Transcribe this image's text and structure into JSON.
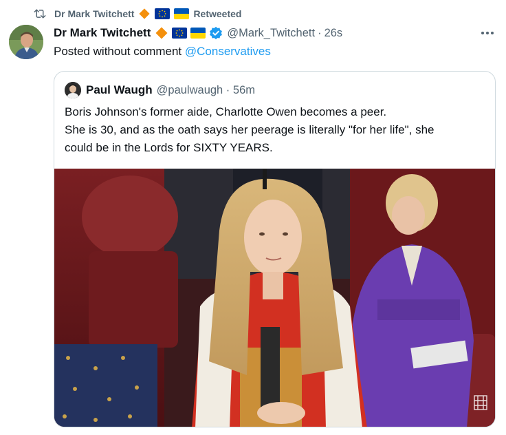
{
  "retweet": {
    "author": "Dr Mark Twitchett",
    "label": "Retweeted"
  },
  "tweet": {
    "author_name": "Dr Mark Twitchett",
    "handle": "@Mark_Twitchett",
    "time": "26s",
    "text_prefix": "Posted without comment ",
    "mention": "@Conservatives",
    "badges": [
      "orange-diamond",
      "eu-flag",
      "ukraine-flag",
      "verified-badge"
    ]
  },
  "quote": {
    "author_name": "Paul Waugh",
    "handle_time": "@paulwaugh · 56m",
    "lines": [
      "Boris Johnson's former aide, Charlotte Owen becomes a peer.",
      "She is 30, and as the oath says her peerage is literally \"for her life\", she",
      "could be in the Lords for SIXTY YEARS."
    ]
  },
  "colors": {
    "text": "#0f1419",
    "secondary": "#536471",
    "link": "#1d9bf0",
    "border": "#cfd9de",
    "diamond": "#f4900c",
    "eu_blue": "#003399",
    "eu_gold": "#ffcc00",
    "ua_blue": "#0057b7",
    "ua_yellow": "#ffd700"
  }
}
